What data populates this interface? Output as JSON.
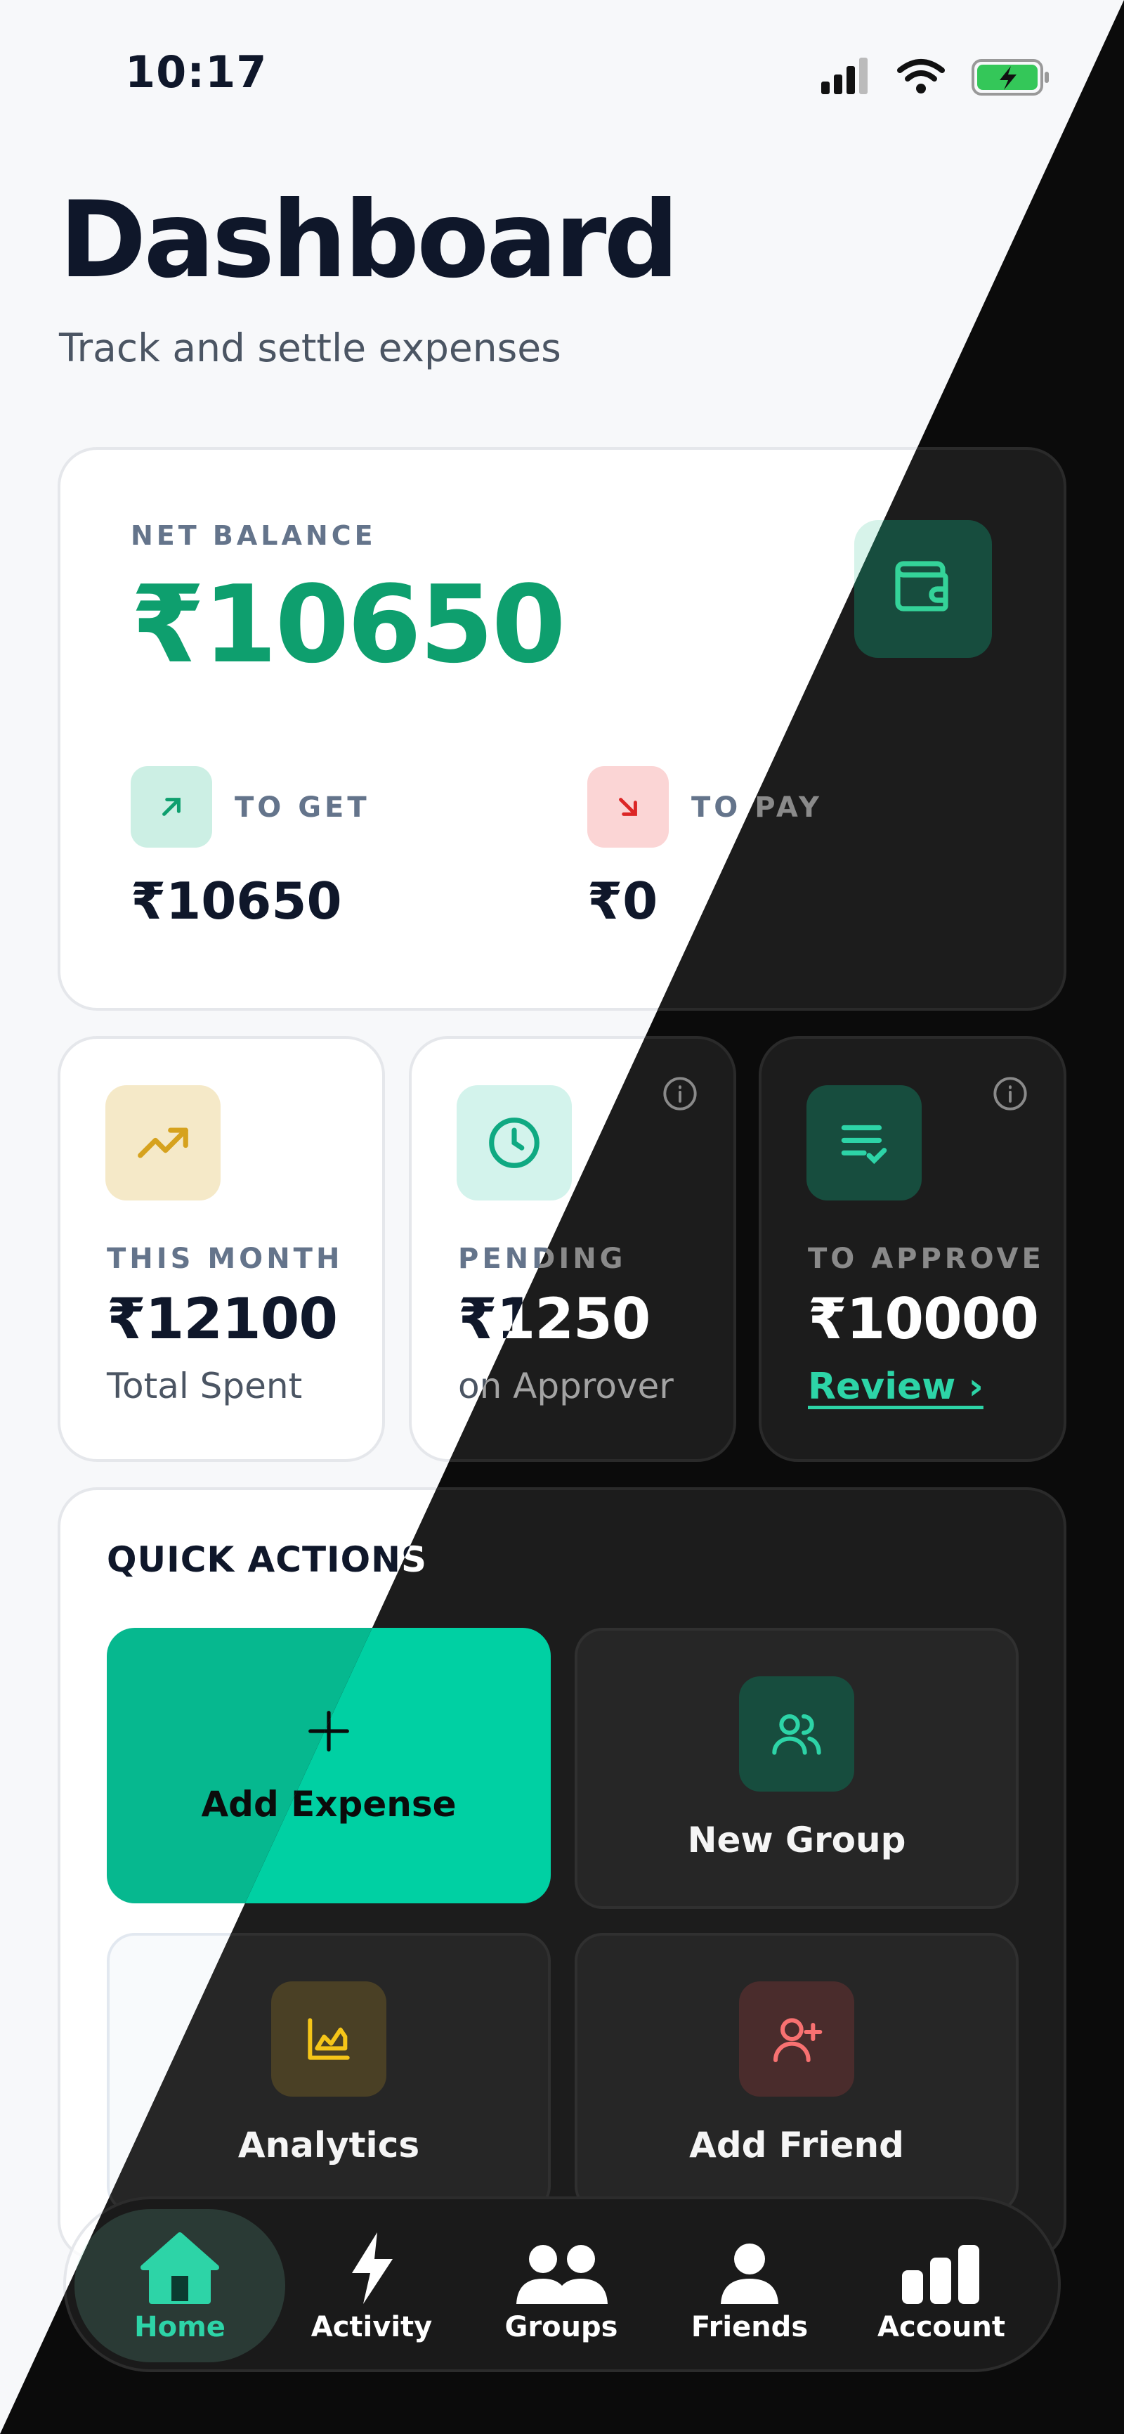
{
  "status_bar": {
    "time": "10:17"
  },
  "header": {
    "title": "Dashboard",
    "subtitle": "Track and settle expenses"
  },
  "balance": {
    "label": "NET BALANCE",
    "amount": "₹10650",
    "to_get_label": "TO GET",
    "to_get_amount": "₹10650",
    "to_pay_label": "TO PAY",
    "to_pay_amount": "₹0"
  },
  "stats": {
    "this_month": {
      "label": "THIS MONTH",
      "amount": "₹12100",
      "note": "Total Spent"
    },
    "pending": {
      "label": "PENDING",
      "amount": "₹1250",
      "note": "on Approver"
    },
    "to_approve": {
      "label": "TO APPROVE",
      "amount": "₹10000",
      "link": "Review ›"
    }
  },
  "quick_actions": {
    "title": "QUICK ACTIONS",
    "add_expense": "Add Expense",
    "new_group": "New Group",
    "analytics": "Analytics",
    "add_friend": "Add Friend"
  },
  "nav": {
    "home": "Home",
    "activity": "Activity",
    "groups": "Groups",
    "friends": "Friends",
    "account": "Account"
  },
  "colors": {
    "accent": "#00d0a3",
    "positive": "#0e9f6e",
    "negative": "#dc2626",
    "warning": "#d6a21e"
  }
}
